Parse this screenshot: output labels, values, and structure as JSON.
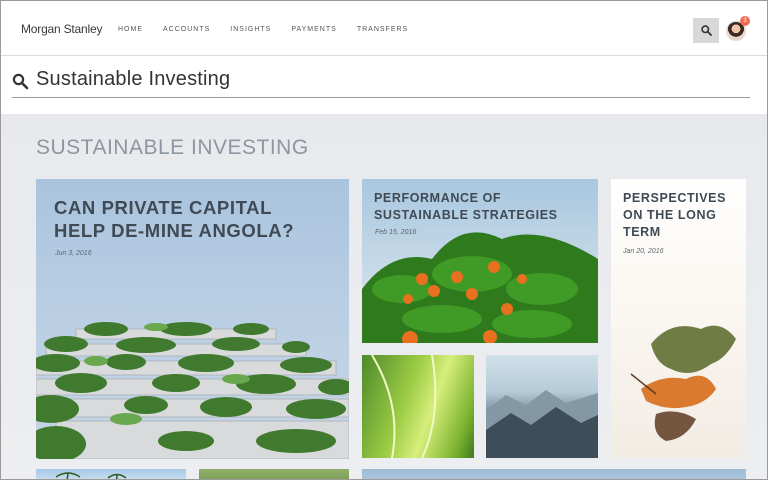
{
  "header": {
    "brand": "Morgan Stanley",
    "nav": [
      "HOME",
      "ACCOUNTS",
      "INSIGHTS",
      "PAYMENTS",
      "TRANSFERS"
    ],
    "notification_count": "3",
    "search_icon": "search-icon"
  },
  "search": {
    "query": "Sustainable Investing",
    "icon": "search-icon"
  },
  "section": {
    "title": "SUSTAINABLE INVESTING"
  },
  "cards": [
    {
      "title": "CAN PRIVATE CAPITAL HELP DE-MINE ANGOLA?",
      "date": "Jun 3, 2016",
      "image": "green-terrace-building-image"
    },
    {
      "title": "PERFORMANCE OF SUSTAINABLE STRATEGIES",
      "date": "Feb 15, 2016",
      "image": "orange-tree-image"
    },
    {
      "title": "PERSPECTIVES ON THE LONG TERM",
      "date": "Jan 20, 2016",
      "image": "autumn-leaf-image"
    },
    {
      "image": "green-leaf-image"
    },
    {
      "image": "mountain-landscape-image"
    },
    {
      "image": "palm-trees-image"
    },
    {
      "image": "green-field-image"
    },
    {
      "image": "sky-landscape-image"
    }
  ],
  "colors": {
    "badge": "#f06a4f",
    "section_title": "#8d96a2",
    "card_title": "#3f4a55"
  }
}
